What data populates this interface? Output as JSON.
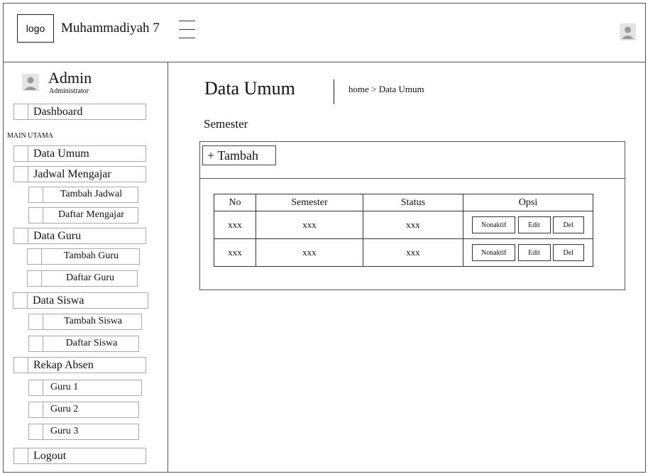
{
  "header": {
    "logo_text": "logo",
    "brand": "Muhammadiyah 7"
  },
  "sidebar": {
    "admin_name": "Admin",
    "admin_role": "Administrator",
    "dashboard": "Dashboard",
    "section_label": "MAIN UTAMA",
    "items": [
      {
        "label": "Data Umum"
      },
      {
        "label": "Jadwal Mengajar"
      },
      {
        "label": "Tambah Jadwal"
      },
      {
        "label": "Daftar Mengajar"
      },
      {
        "label": "Data Guru"
      },
      {
        "label": "Tambah Guru"
      },
      {
        "label": "Daftar Guru"
      },
      {
        "label": "Data Siswa"
      },
      {
        "label": "Tambah Siswa"
      },
      {
        "label": "Daftar Siswa"
      },
      {
        "label": "Rekap Absen"
      },
      {
        "label": "Guru 1"
      },
      {
        "label": "Guru 2"
      },
      {
        "label": "Guru 3"
      },
      {
        "label": "Logout"
      }
    ]
  },
  "main": {
    "title": "Data Umum",
    "breadcrumb": "home > Data Umum",
    "subheading": "Semester",
    "add_button": "+ Tambah",
    "table": {
      "headers": [
        "No",
        "Semester",
        "Status",
        "Opsi"
      ],
      "rows": [
        {
          "no": "xxx",
          "semester": "xxx",
          "status": "xxx"
        },
        {
          "no": "xxx",
          "semester": "xxx",
          "status": "xxx"
        }
      ],
      "actions": {
        "deactivate": "Nonaktif",
        "edit": "Edit",
        "delete": "Del"
      }
    }
  },
  "icons": {
    "menu": "hamburger-menu-icon",
    "user": "user-avatar-icon"
  }
}
